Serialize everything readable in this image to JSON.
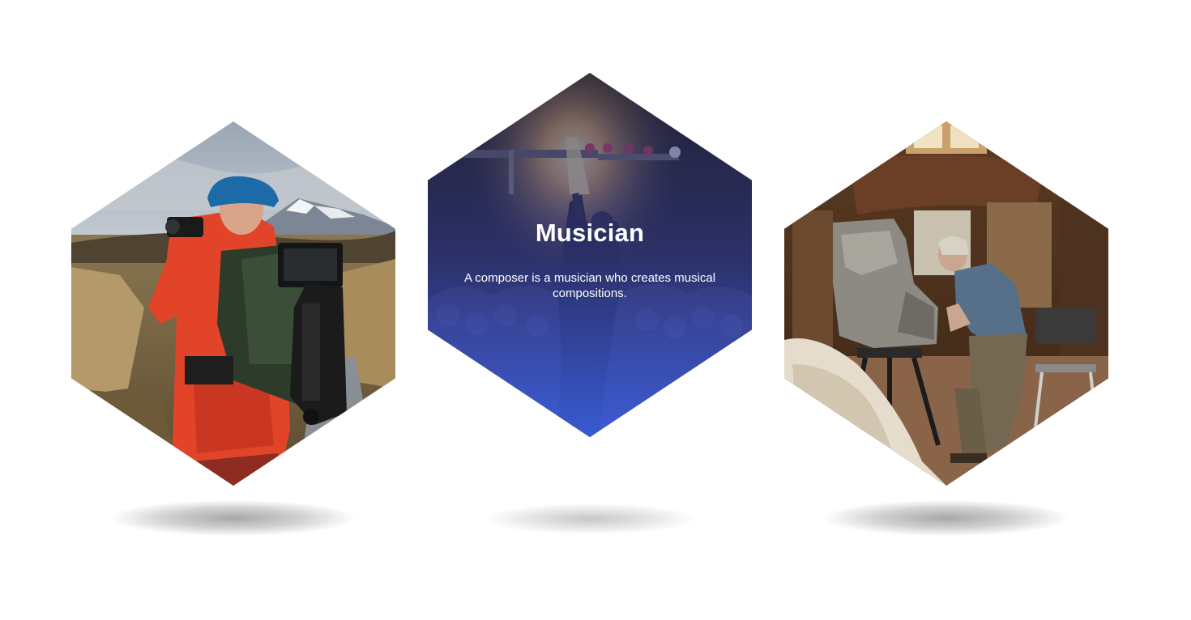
{
  "cards": [
    {
      "id": "photographer",
      "image": "photographer-hiking-with-camera-photo"
    },
    {
      "id": "musician",
      "image": "concert-performer-crowd-photo",
      "title": "Musician",
      "description": "A composer is a musician who creates musical compositions."
    },
    {
      "id": "sculptor",
      "image": "sculptor-in-workshop-photo"
    }
  ],
  "colors": {
    "background": "#ffffff",
    "overlay_top": "#1e1e37",
    "overlay_bottom": "#3c64f0",
    "text": "#ffffff"
  }
}
